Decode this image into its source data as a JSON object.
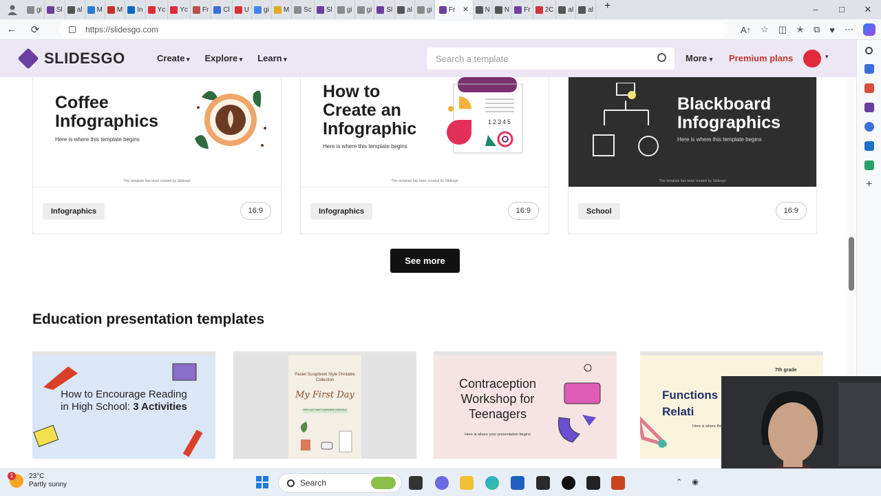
{
  "browser": {
    "tabs": [
      "gi",
      "Sl",
      "al",
      "M",
      "M",
      "In",
      "Yc",
      "Yc",
      "Fr",
      "Cl",
      "U",
      "gi",
      "M",
      "Sc",
      "Sl",
      "gi",
      "gi",
      "Sl",
      "al",
      "gi",
      "Fr",
      "N",
      "N",
      "Fr",
      "2C",
      "al",
      "al"
    ],
    "active_tab_index": 20,
    "url": "https://slidesgo.com"
  },
  "site": {
    "logo": "SLIDESGO",
    "nav": [
      "Create",
      "Explore",
      "Learn"
    ],
    "search_placeholder": "Search a template",
    "more": "More",
    "premium": "Premium plans"
  },
  "top_cards": [
    {
      "title_lines": [
        "Coffee",
        "Infographics"
      ],
      "subtitle": "Here is where this template begins",
      "tag": "Infographics",
      "ratio": "16:9",
      "dark": false
    },
    {
      "title_lines": [
        "How to",
        "Create an",
        "Infographic"
      ],
      "subtitle": "Here is where this template begins",
      "tag": "Infographics",
      "ratio": "16:9",
      "dark": false,
      "numbers": "12345"
    },
    {
      "title_lines": [
        "Blackboard",
        "Infographics"
      ],
      "subtitle": "Here is where this template begins",
      "tag": "School",
      "ratio": "16:9",
      "dark": true
    }
  ],
  "see_more": "See more",
  "section_title": "Education presentation templates",
  "education_cards": [
    {
      "title": "How to Encourage Reading in High School: ",
      "title_bold": "3 Activities",
      "bg": "#dbe6f7"
    },
    {
      "pre": "Pastel Scrapbook Style Printable Collection",
      "title": "My First Day",
      "sub": "Here you have a printable collection",
      "bg": "#e7e7e7"
    },
    {
      "title": "Contraception Workshop for Teenagers",
      "sub": "Here is where your presentation begins",
      "bg": "#f6e4e4"
    },
    {
      "title": "Functions Relati",
      "grade": "7th grade",
      "sub": "Here is where this template begins",
      "bg": "#faf4dc"
    }
  ],
  "taskbar": {
    "temperature": "23°C",
    "weather": "Partly sunny",
    "weather_badge": "1",
    "search": "Search"
  },
  "colors": {
    "header_bg": "#ece6f5",
    "brand": "#6b3fa0",
    "premium": "#c0392b"
  }
}
